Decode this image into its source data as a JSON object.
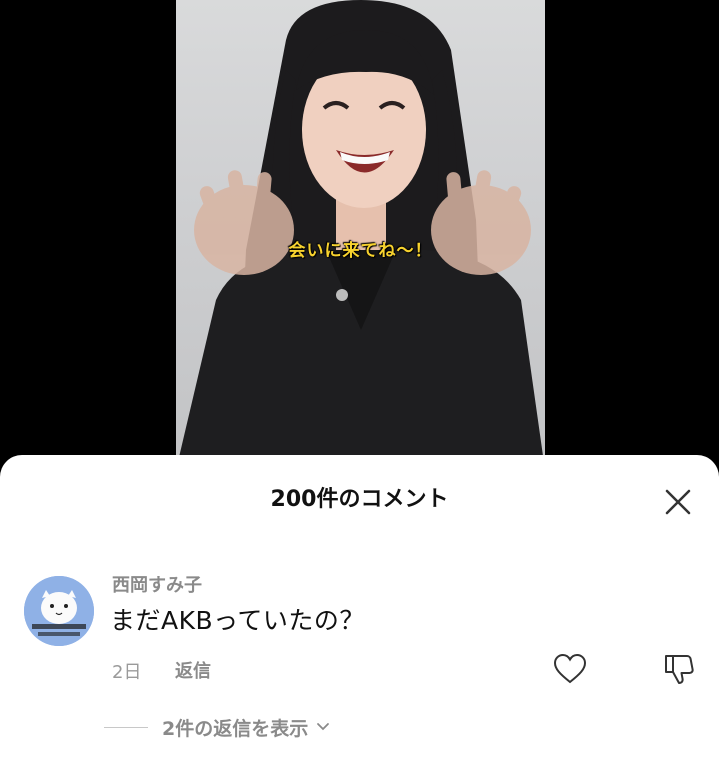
{
  "video": {
    "caption": "会いに来てね〜！"
  },
  "comments_sheet": {
    "title": "200件のコメント",
    "comment": {
      "author": "西岡すみ子",
      "text": "まだAKBっていたの？",
      "time": "2日",
      "reply_label": "返信"
    },
    "view_replies_label": "2件の返信を表示"
  },
  "colors": {
    "background": "#000000",
    "sheet": "#ffffff",
    "caption": "#f7d22e",
    "muted_text": "#8a8a8a"
  },
  "icons": [
    "close-icon",
    "heart-icon",
    "thumbs-down-icon",
    "chevron-down-icon"
  ]
}
